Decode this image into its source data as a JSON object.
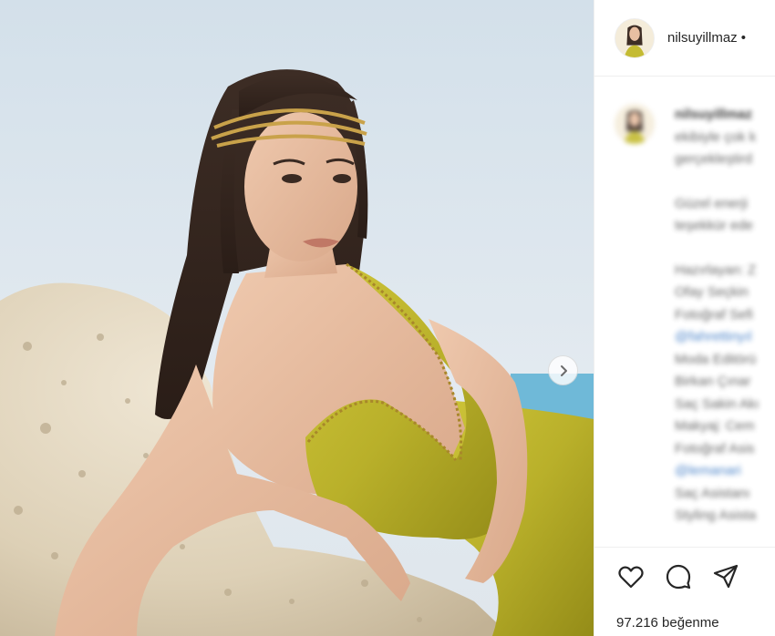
{
  "post": {
    "username": "nilsuyillmaz",
    "header_more": "•",
    "media": {
      "image": "portrait-woman-green-strapless-dress-gold-headpiece-reclining-on-rock",
      "next_icon": "chevron-right-icon"
    },
    "caption": {
      "username": "nilsuyillmaz",
      "lines": [
        "ekibiyle çok k",
        "gerçekleştird",
        "",
        "Güzel enerji",
        "teşekkür ede",
        "",
        "Hazırlayan: Z",
        "Ofay Seçkin",
        "Fotoğraf Sefi",
        "@fahrettinyıl",
        "Moda Editörü",
        "Birkan Çınar",
        "Saç Sakin Akı",
        "Makyaj: Cem",
        "Fotoğraf Asis",
        "@lemanari",
        "Saç Asistanı",
        "Styling Asista"
      ]
    },
    "actions": {
      "like_icon": "heart-icon",
      "comment_icon": "comment-icon",
      "share_icon": "share-icon"
    },
    "likes_text": "97.216 beğenme"
  }
}
